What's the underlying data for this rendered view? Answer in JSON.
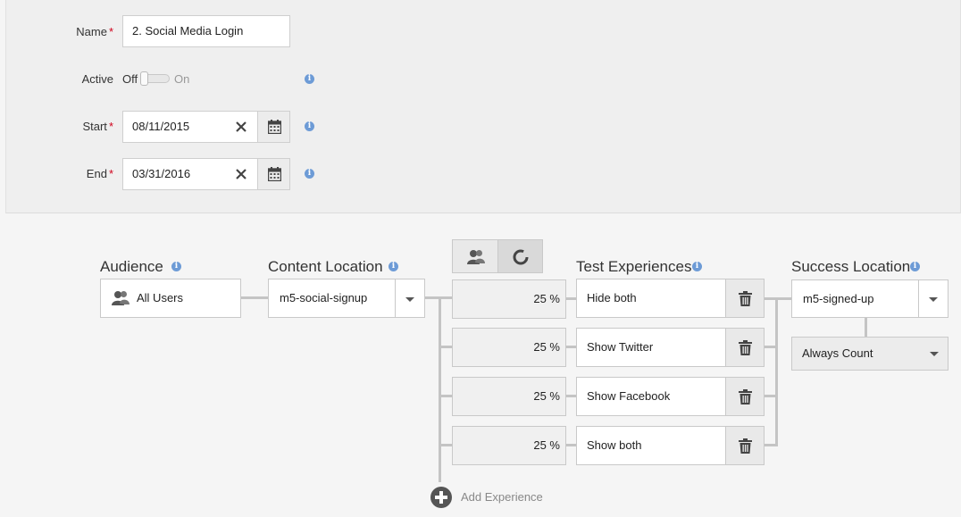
{
  "form": {
    "name_label": "Name",
    "required_mark": "*",
    "name_value": "2. Social Media Login",
    "active_label": "Active",
    "toggle_off_label": "Off",
    "toggle_on_label": "On",
    "toggle_state": "off",
    "start_label": "Start",
    "start_value": "08/11/2015",
    "end_label": "End",
    "end_value": "03/31/2016"
  },
  "flow": {
    "audience_title": "Audience",
    "audience_value": "All Users",
    "content_location_title": "Content Location",
    "content_location_value": "m5-social-signup",
    "allocation_mode": "manual",
    "test_experiences_title": "Test Experiences",
    "experiences": [
      {
        "percent": "25 %",
        "name": "Hide both"
      },
      {
        "percent": "25 %",
        "name": "Show Twitter"
      },
      {
        "percent": "25 %",
        "name": "Show Facebook"
      },
      {
        "percent": "25 %",
        "name": "Show both"
      }
    ],
    "success_location_title": "Success Location",
    "success_location_value": "m5-signed-up",
    "count_mode_value": "Always Count",
    "add_experience_label": "Add Experience"
  },
  "colors": {
    "info_icon": "#6d9bd6",
    "required": "#d0021b",
    "connector": "#c4c4c4"
  }
}
